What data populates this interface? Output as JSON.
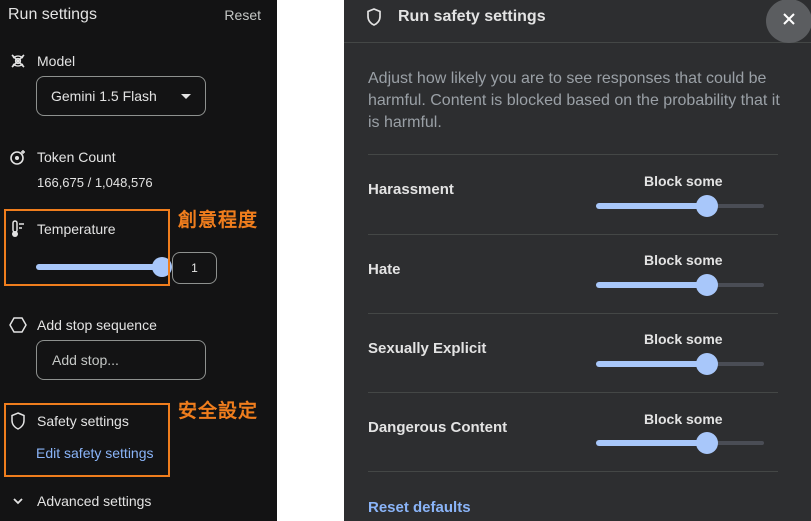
{
  "left_panel": {
    "title": "Run settings",
    "reset_label": "Reset",
    "model": {
      "label": "Model",
      "selected": "Gemini 1.5 Flash"
    },
    "token_count": {
      "label": "Token Count",
      "value": "166,675 / 1,048,576"
    },
    "temperature": {
      "label": "Temperature",
      "value": "1",
      "slider_fraction": 1.0
    },
    "stop_sequence": {
      "label": "Add stop sequence",
      "placeholder": "Add stop..."
    },
    "safety": {
      "label": "Safety settings",
      "link": "Edit safety settings"
    },
    "advanced": {
      "label": "Advanced settings"
    }
  },
  "annotations": {
    "temperature_note": "創意程度",
    "safety_note": "安全設定"
  },
  "safety_panel": {
    "title": "Run safety settings",
    "description": "Adjust how likely you are to see responses that could be harmful. Content is blocked based on the probability that it is harmful.",
    "categories": [
      {
        "label": "Harassment",
        "level": "Block some",
        "slider_fraction": 0.66
      },
      {
        "label": "Hate",
        "level": "Block some",
        "slider_fraction": 0.66
      },
      {
        "label": "Sexually Explicit",
        "level": "Block some",
        "slider_fraction": 0.66
      },
      {
        "label": "Dangerous Content",
        "level": "Block some",
        "slider_fraction": 0.66
      }
    ],
    "reset_defaults": "Reset defaults"
  },
  "colors": {
    "accent_slider": "#a8c7fa",
    "link": "#8ab4f8",
    "annotation_orange": "#ef7d1d"
  },
  "icons": {
    "model": "model-icon",
    "token": "token-count-icon",
    "temperature": "thermometer-icon",
    "stop": "hexagon-icon",
    "safety": "shield-icon",
    "advanced": "chevron-down-icon",
    "close": "close-icon"
  }
}
